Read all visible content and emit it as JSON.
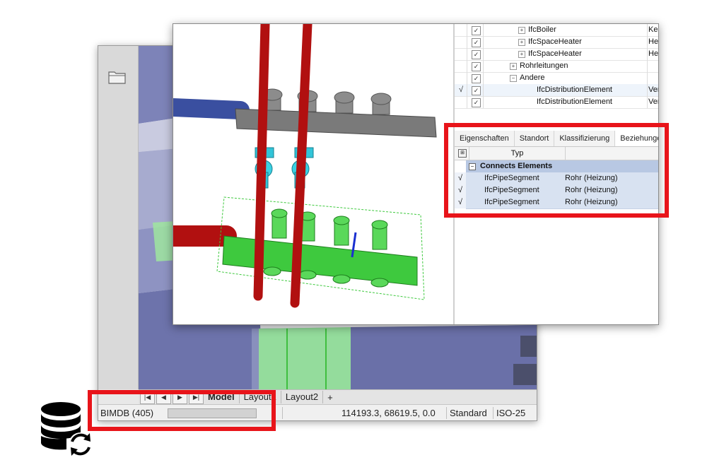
{
  "back_window": {
    "layout_tabs": {
      "nav": [
        "|◀",
        "◀",
        "▶",
        "▶|"
      ],
      "tabs": [
        {
          "label": "Model",
          "active": true
        },
        {
          "label": "Layout1",
          "active": false
        },
        {
          "label": "Layout2",
          "active": false
        }
      ],
      "add_label": "+"
    },
    "status_bar": {
      "db_label": "BIMDB (405)",
      "progress": 0,
      "coordinates": "114193.3, 68619.5, 0.0",
      "visual_style": "Standard",
      "dim_style": "ISO-25"
    }
  },
  "front_window": {
    "tree_rows": [
      {
        "check": "",
        "checked": true,
        "indent": 90,
        "expander": "+",
        "label": "IfcBoiler",
        "col2": "Kes",
        "selected": false
      },
      {
        "check": "",
        "checked": true,
        "indent": 90,
        "expander": "+",
        "label": "IfcSpaceHeater",
        "col2": "He",
        "selected": false
      },
      {
        "check": "",
        "checked": true,
        "indent": 90,
        "expander": "+",
        "label": "IfcSpaceHeater",
        "col2": "He",
        "selected": false
      },
      {
        "check": "",
        "checked": true,
        "indent": 78,
        "expander": "+",
        "label": "Rohrleitungen",
        "col2": "",
        "selected": false
      },
      {
        "check": "",
        "checked": true,
        "indent": 78,
        "expander": "−",
        "label": "Andere",
        "col2": "",
        "selected": false
      },
      {
        "check": "√",
        "checked": true,
        "indent": 102,
        "expander": "",
        "label": "IfcDistributionElement",
        "col2": "Ver",
        "selected": true
      },
      {
        "check": "",
        "checked": true,
        "indent": 102,
        "expander": "",
        "label": "IfcDistributionElement",
        "col2": "Ver",
        "selected": false
      }
    ],
    "property_tabs": [
      {
        "label": "Eigenschaften",
        "active": false
      },
      {
        "label": "Standort",
        "active": false
      },
      {
        "label": "Klassifizierung",
        "active": false
      },
      {
        "label": "Beziehungen",
        "active": true
      }
    ],
    "relations": {
      "column_header": "Typ",
      "group_label": "Connects Elements",
      "rows": [
        {
          "check": "√",
          "type": "IfcPipeSegment",
          "name": "Rohr (Heizung)"
        },
        {
          "check": "√",
          "type": "IfcPipeSegment",
          "name": "Rohr (Heizung)"
        },
        {
          "check": "√",
          "type": "IfcPipeSegment",
          "name": "Rohr (Heizung)"
        }
      ]
    }
  },
  "icons": {
    "sidebar_folder": "folder-icon",
    "database_sync": "database-sync-icon",
    "grid_header": "grid-icon"
  },
  "colors": {
    "highlight": "#e8141a",
    "selection_group": "#b8c8e3",
    "selected_element": "#3ec93e"
  }
}
